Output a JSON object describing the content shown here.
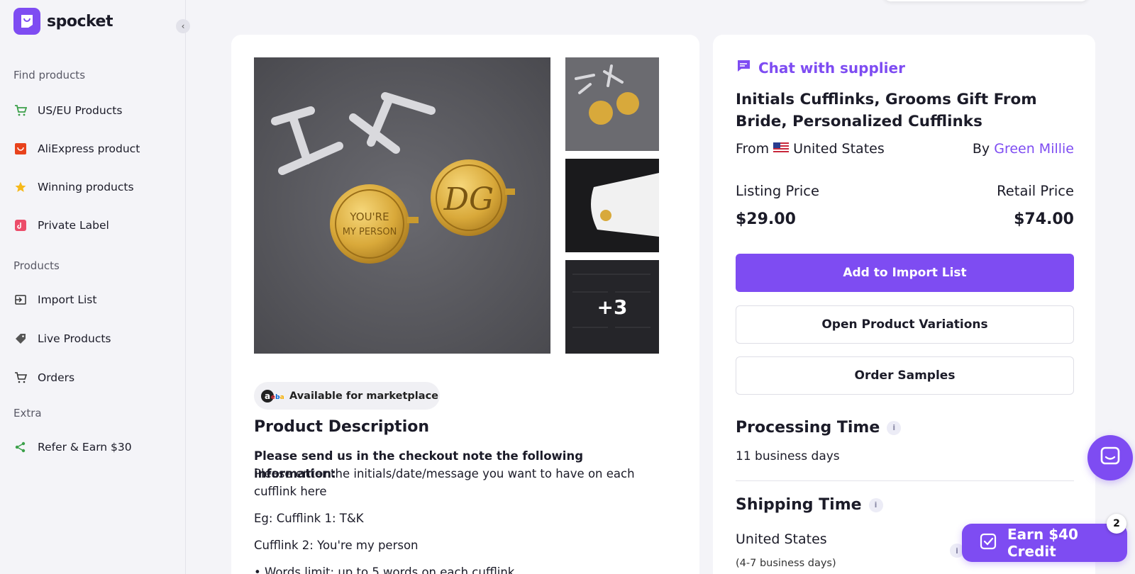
{
  "brand": {
    "name": "spocket",
    "accent": "#7e4cf2"
  },
  "sidebar": {
    "sections": [
      {
        "label": "Find products"
      },
      {
        "label": "Products"
      },
      {
        "label": "Extra"
      }
    ],
    "items": [
      {
        "label": "US/EU Products",
        "icon": "cart-icon"
      },
      {
        "label": "AliExpress product",
        "icon": "aliexpress-icon"
      },
      {
        "label": "Winning products",
        "icon": "star-icon"
      },
      {
        "label": "Private Label",
        "icon": "private-label-icon"
      },
      {
        "label": "Import List",
        "icon": "import-icon"
      },
      {
        "label": "Live Products",
        "icon": "tag-icon"
      },
      {
        "label": "Orders",
        "icon": "cart-outline-icon"
      },
      {
        "label": "Refer & Earn $30",
        "icon": "share-icon"
      }
    ]
  },
  "gallery": {
    "more_count": "+3"
  },
  "marketplace": {
    "label": "Available for marketplace"
  },
  "description": {
    "title": "Product Description",
    "bold_line": "Please send us in the checkout note the following information:",
    "line1": "Please enter the initials/date/message you want to have on each cufflink here",
    "line2": "Eg: Cufflink 1: T&K",
    "line3": "Cufflink 2: You're my person",
    "line4": "• Words limit: up to 5 words on each cufflink"
  },
  "product": {
    "chat_label": "Chat with supplier",
    "title": "Initials Cufflinks, Grooms Gift From Bride, Personalized Cufflinks",
    "from_label": "From",
    "country": "United States",
    "by_label": "By",
    "supplier": "Green Millie",
    "listing_price_label": "Listing Price",
    "listing_price": "$29.00",
    "retail_price_label": "Retail Price",
    "retail_price": "$74.00",
    "add_button": "Add to Import List",
    "variations_button": "Open Product Variations",
    "samples_button": "Order Samples",
    "processing_label": "Processing Time",
    "processing_value": "11 business days",
    "shipping_label": "Shipping Time",
    "shipping_country": "United States",
    "shipping_days": "(4-7 business days)"
  },
  "promo": {
    "earn_label": "Earn $40 Credit",
    "badge_count": "2"
  }
}
